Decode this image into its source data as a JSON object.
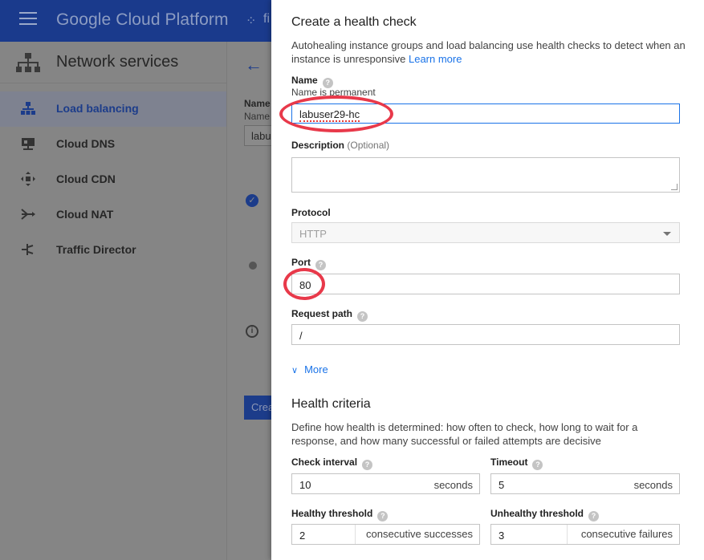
{
  "console": {
    "brand": "Google Cloud Platform",
    "project_partial": "fi",
    "sidebar_title": "Network services",
    "nav_items": [
      {
        "label": "Load balancing",
        "icon": "load-balancing-icon",
        "active": true
      },
      {
        "label": "Cloud DNS",
        "icon": "cloud-dns-icon",
        "active": false
      },
      {
        "label": "Cloud CDN",
        "icon": "cloud-cdn-icon",
        "active": false
      },
      {
        "label": "Cloud NAT",
        "icon": "cloud-nat-icon",
        "active": false
      },
      {
        "label": "Traffic Director",
        "icon": "traffic-director-icon",
        "active": false
      }
    ],
    "main": {
      "name_label_partial": "Name",
      "name_hint_partial": "Name",
      "name_value_partial": "labu",
      "create_partial": "Crea"
    }
  },
  "panel": {
    "title": "Create a health check",
    "description": "Autohealing instance groups and load balancing use health checks to detect when an instance is unresponsive",
    "learn_more": "Learn more",
    "name": {
      "label": "Name",
      "hint": "Name is permanent",
      "value": "labuser29-hc"
    },
    "description_field": {
      "label": "Description",
      "optional": "(Optional)",
      "value": ""
    },
    "protocol": {
      "label": "Protocol",
      "value": "HTTP"
    },
    "port": {
      "label": "Port",
      "value": "80"
    },
    "request_path": {
      "label": "Request path",
      "value": "/"
    },
    "more": "More",
    "health_criteria": {
      "title": "Health criteria",
      "description": "Define how health is determined: how often to check, how long to wait for a response, and how many successful or failed attempts are decisive",
      "check_interval": {
        "label": "Check interval",
        "value": "10",
        "unit": "seconds"
      },
      "timeout": {
        "label": "Timeout",
        "value": "5",
        "unit": "seconds"
      },
      "healthy_threshold": {
        "label": "Healthy threshold",
        "value": "2",
        "unit": "consecutive successes"
      },
      "unhealthy_threshold": {
        "label": "Unhealthy threshold",
        "value": "3",
        "unit": "consecutive failures"
      }
    }
  },
  "colors": {
    "topbar": "#1a3a8c",
    "link": "#1a73e8",
    "focus": "#1a73e8",
    "annotation": "#e8394a",
    "overlay": "#858585"
  }
}
